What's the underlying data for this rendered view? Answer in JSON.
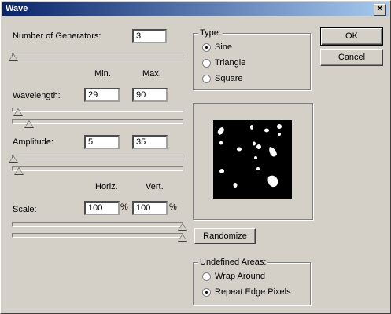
{
  "window": {
    "title": "Wave"
  },
  "generators": {
    "label": "Number of Generators:",
    "value": "3",
    "level": 0.02
  },
  "headers": {
    "min": "Min.",
    "max": "Max.",
    "horiz": "Horiz.",
    "vert": "Vert."
  },
  "wavelength": {
    "label": "Wavelength:",
    "min": "29",
    "max": "90"
  },
  "amplitude": {
    "label": "Amplitude:",
    "min": "5",
    "max": "35"
  },
  "scale": {
    "label": "Scale:",
    "horiz": "100",
    "vert": "100",
    "unit": "%"
  },
  "type": {
    "legend": "Type:",
    "options": [
      "Sine",
      "Triangle",
      "Square"
    ],
    "selected": "Sine"
  },
  "buttons": {
    "ok": "OK",
    "cancel": "Cancel",
    "randomize": "Randomize"
  },
  "undefined_areas": {
    "legend": "Undefined Areas:",
    "options": [
      "Wrap Around",
      "Repeat Edge Pixels"
    ],
    "selected": "Repeat Edge Pixels"
  },
  "colors": {
    "titlebar_start": "#0a246a",
    "titlebar_end": "#a6caf0",
    "face": "#d4d0c8"
  }
}
